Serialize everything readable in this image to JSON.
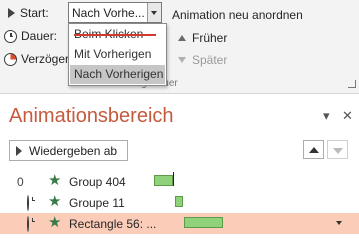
{
  "ribbon": {
    "start_label": "Start:",
    "start_value": "Nach Vorhe...",
    "reorder_label": "Animation neu anordnen",
    "duration_label": "Dauer:",
    "delay_label": "Verzöger",
    "earlier_label": "Früher",
    "later_label": "Später",
    "group_label": "Anzeigedauer",
    "dropdown_options": [
      "Beim Klicken",
      "Mit Vorherigen",
      "Nach Vorherigen"
    ],
    "selected_option": "Nach Vorherigen"
  },
  "pane": {
    "title": "Animationsbereich",
    "close_glyph": "✕",
    "menu_glyph": "▾",
    "play_label": "Wiedergeben ab",
    "items": [
      {
        "index": "0",
        "name": "Group 404",
        "selected": false
      },
      {
        "index": "",
        "name": "Groupe 11",
        "selected": false
      },
      {
        "index": "",
        "name": "Rectangle 56: ...",
        "selected": true
      }
    ]
  },
  "colors": {
    "accent_title": "#c55a3c",
    "selected_row": "#fbcdb9",
    "bar_fill": "#8fd27a",
    "strike": "#d23a2f"
  }
}
